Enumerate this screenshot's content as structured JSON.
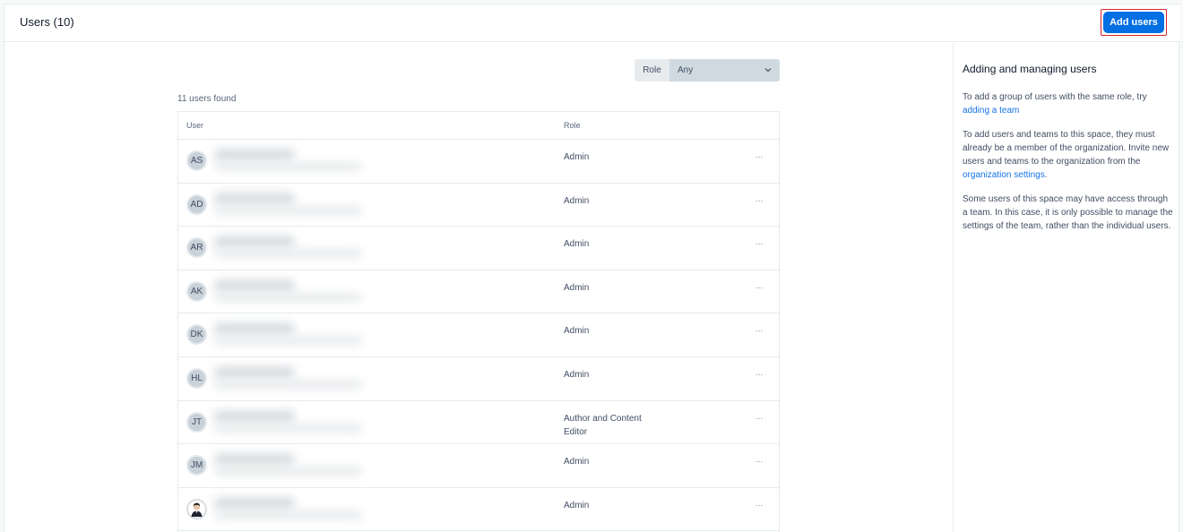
{
  "header": {
    "title": "Users (10)",
    "add_button": "Add users"
  },
  "filter": {
    "label": "Role",
    "value": "Any"
  },
  "results": {
    "count_text": "11 users found"
  },
  "table": {
    "columns": [
      "User",
      "Role"
    ],
    "rows": [
      {
        "initials": "AS",
        "role": "Admin",
        "actions": "..."
      },
      {
        "initials": "AD",
        "role": "Admin",
        "actions": "..."
      },
      {
        "initials": "AR",
        "role": "Admin",
        "actions": "..."
      },
      {
        "initials": "AK",
        "role": "Admin",
        "actions": "..."
      },
      {
        "initials": "DK",
        "role": "Admin",
        "actions": "..."
      },
      {
        "initials": "HL",
        "role": "Admin",
        "actions": "..."
      },
      {
        "initials": "JT",
        "role": "Author and Content Editor",
        "actions": "..."
      },
      {
        "initials": "JM",
        "role": "Admin",
        "actions": "..."
      },
      {
        "initials": "",
        "role": "Admin",
        "actions": "...",
        "avatar_icon": "user-photo-icon"
      }
    ]
  },
  "sidebar": {
    "heading": "Adding and managing users",
    "p1_text": "To add a group of users with the same role, try",
    "p1_link": "adding a team",
    "p2_text": "To add users and teams to this space, they must already be a member of the organization. Invite new users and teams to the organization from the",
    "p2_link": "organization settings",
    "p2_end": ".",
    "p3_text": "Some users of this space may have access through a team. In this case, it is only possible to manage the settings of the team, rather than the individual users."
  },
  "colors": {
    "accent": "#036fe3",
    "highlight": "#d9232e",
    "link": "#1672e6"
  }
}
